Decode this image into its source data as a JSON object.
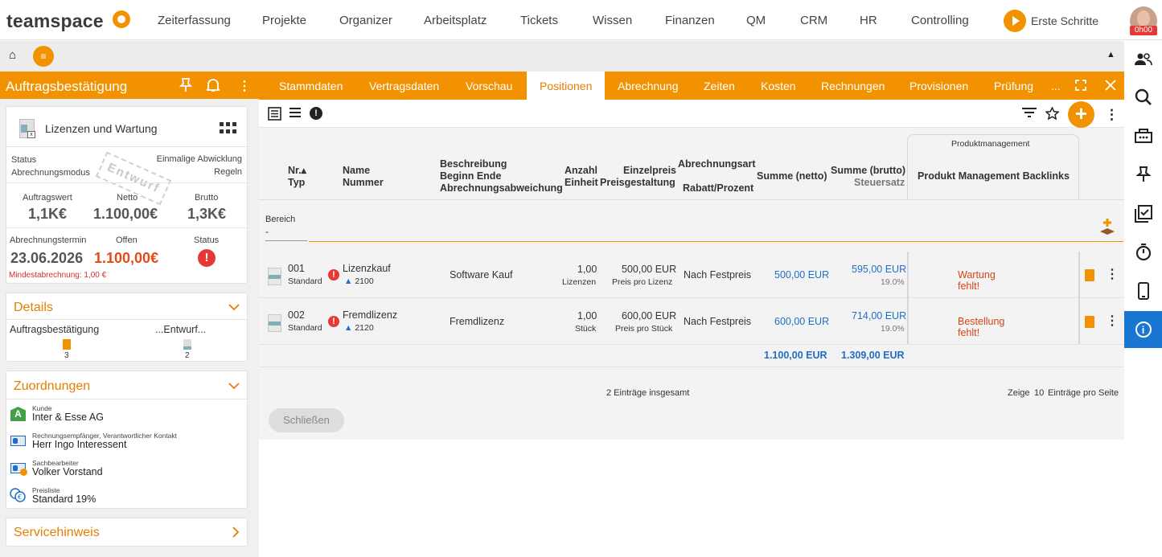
{
  "app": {
    "logo": "teamspace",
    "time_badge": "0h00",
    "erste_schritte": "Erste Schritte"
  },
  "topnav": {
    "items": [
      "Zeiterfassung",
      "Projekte",
      "Organizer",
      "Arbeitsplatz",
      "Tickets",
      "Wissen",
      "Finanzen",
      "QM",
      "CRM",
      "HR",
      "Controlling"
    ]
  },
  "subbar": {
    "home_icon": "⌂",
    "menu_icon": "≡",
    "collapse_icon": "▲"
  },
  "left": {
    "header_title": "Auftragsbestätigung",
    "summary": {
      "title": "Lizenzen und Wartung",
      "status_label": "Status",
      "status_value": "Einmalige Abwicklung",
      "abrechnungsmodus_label": "Abrechnungsmodus",
      "abrechnungsmodus_value": "Regeln",
      "stamp": "Entwurf",
      "auftragswert_label": "Auftragswert",
      "auftragswert_value": "1,1K€",
      "netto_label": "Netto",
      "netto_value": "1.100,00€",
      "brutto_label": "Brutto",
      "brutto_value": "1,3K€",
      "termin_label": "Abrechnungstermin",
      "termin_value": "23.06.2026",
      "offen_label": "Offen",
      "offen_value": "1.100,00€",
      "status2_label": "Status",
      "mindest": "Mindestabrechnung: 1,00 €"
    },
    "details": {
      "title": "Details",
      "col1_label": "Auftragsbestätigung",
      "col1_count": "3",
      "col2_label": "...Entwurf...",
      "col2_count": "2"
    },
    "zuordnungen": {
      "title": "Zuordnungen",
      "items": [
        {
          "label": "Kunde",
          "value": "Inter & Esse AG"
        },
        {
          "label": "Rechnungsempfänger, Verantwortlicher Kontakt",
          "value": "Herr Ingo Interessent"
        },
        {
          "label": "Sachbearbeiter",
          "value": "Volker Vorstand"
        },
        {
          "label": "Preisliste",
          "value": "Standard 19%"
        }
      ]
    },
    "servicehinweis": {
      "title": "Servicehinweis"
    }
  },
  "tabs": [
    "Stammdaten",
    "Vertragsdaten",
    "Vorschau",
    "Positionen",
    "Abrechnung",
    "Zeiten",
    "Kosten",
    "Rechnungen",
    "Provisionen",
    "Prüfung",
    "..."
  ],
  "table": {
    "headers": {
      "nr": "Nr.▴",
      "typ": "Typ",
      "name": "Name",
      "nummer": "Nummer",
      "beschreibung": "Beschreibung",
      "beginn_ende": "Beginn Ende",
      "abw": "Abrechnungsabweichung",
      "anzahl": "Anzahl",
      "einheit": "Einheit",
      "einzelpreis": "Einzelpreis",
      "preisgestaltung": "Preisgestaltung",
      "abrechnungsart": "Abrechnungsart",
      "rabatt": "Rabatt/Prozent",
      "summe_netto": "Summe (netto)",
      "summe_brutto": "Summe (brutto)",
      "steuersatz": "Steuersatz",
      "pm_group": "Produktmanagement",
      "pm_col": "Produkt Management Backlinks"
    },
    "bereich_label": "Bereich",
    "bereich_value": "-",
    "rows": [
      {
        "nr": "001",
        "typ": "Standard",
        "name": "Lizenzkauf",
        "nummer": "2100",
        "beschreibung": "Software Kauf",
        "anzahl": "1,00",
        "einheit": "Lizenzen",
        "einzelpreis": "500,00 EUR",
        "preisgestaltung": "Preis pro Lizenz",
        "abrechnungsart": "Nach Festpreis",
        "summe_netto": "500,00 EUR",
        "summe_brutto": "595,00 EUR",
        "steuersatz": "19.0%",
        "pm_line1": "Wartung",
        "pm_line2": "fehlt!"
      },
      {
        "nr": "002",
        "typ": "Standard",
        "name": "Fremdlizenz",
        "nummer": "2120",
        "beschreibung": "Fremdlizenz",
        "anzahl": "1,00",
        "einheit": "Stück",
        "einzelpreis": "600,00 EUR",
        "preisgestaltung": "Preis pro Stück",
        "abrechnungsart": "Nach Festpreis",
        "summe_netto": "600,00 EUR",
        "summe_brutto": "714,00 EUR",
        "steuersatz": "19.0%",
        "pm_line1": "Bestellung",
        "pm_line2": "fehlt!"
      }
    ],
    "total_netto": "1.100,00 EUR",
    "total_brutto": "1.309,00 EUR",
    "footer_count": "2 Einträge insgesamt",
    "footer_zeige": "Zeige",
    "footer_num": "10",
    "footer_pro_seite": "Einträge pro Seite"
  },
  "buttons": {
    "close": "Schließen"
  },
  "colors": {
    "accent": "#f39200",
    "link_blue": "#1e6ec8",
    "warning_red": "#d84315",
    "active_sidebar": "#1976d2"
  }
}
